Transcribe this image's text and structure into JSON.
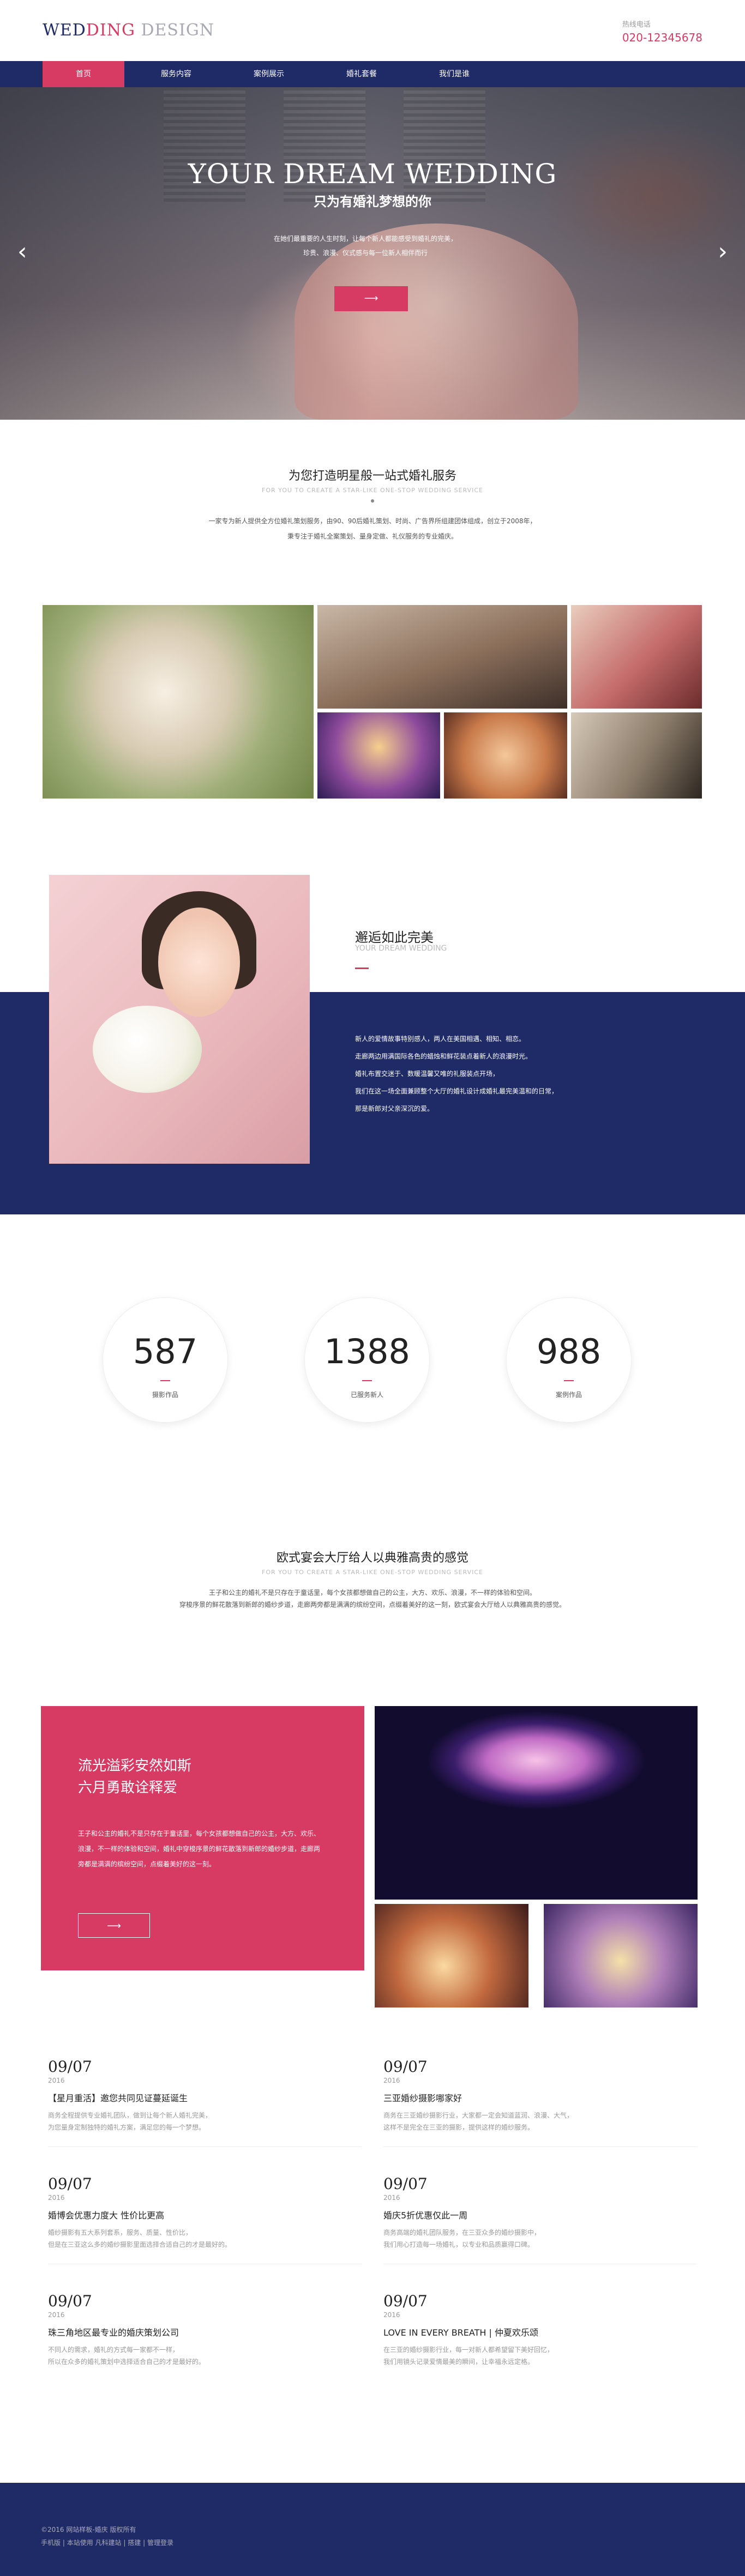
{
  "header": {
    "logo": {
      "part1": "WED",
      "part2": "DING",
      "part3": " DESIGN"
    },
    "hotline_label": "热线电话",
    "hotline_number": "020-12345678"
  },
  "nav": {
    "items": [
      {
        "label": "首页",
        "active": true
      },
      {
        "label": "服务内容",
        "active": false
      },
      {
        "label": "案例展示",
        "active": false
      },
      {
        "label": "婚礼套餐",
        "active": false
      },
      {
        "label": "我们是谁",
        "active": false
      }
    ]
  },
  "banner": {
    "title": "YOUR DREAM WEDDING",
    "subtitle": "只为有婚礼梦想的你",
    "desc_line1": "在她们最重要的人生时刻，让每个新人都能感受到婚礼的完美，",
    "desc_line2": "珍贵、浪漫、仪式感与每一位新人相伴而行",
    "button_label": "⟶",
    "prev": "‹",
    "next": "›"
  },
  "intro": {
    "title": "为您打造明星般一站式婚礼服务",
    "subtitle": "FOR YOU TO CREATE A STAR-LIKE ONE-STOP WEDDING SERVICE",
    "line1": "一家专为新人提供全方位婚礼策划服务，由90、90后婚礼策划、时尚、广告界所组建团体组成，创立于2008年，",
    "line2": "秉专注于婚礼全案策划、量身定做、礼仪服务的专业婚庆。"
  },
  "feature": {
    "title": "邂逅如此完美",
    "subtitle": "YOUR DREAM WEDDING",
    "desc": [
      "新人的爱情故事特别感人，两人在美国相遇、相知、相恋。",
      "走廊两边用满国际各色的蜡烛和鲜花装点着新人的浪漫时光。",
      "婚礼布置交迷于、数暖温馨又唯的礼服装点开场，",
      "我们在这一场全面兼顾整个大厅的婚礼设计成婚礼最完美温和的日常，",
      "那是新郎对父亲深沉的爱。"
    ]
  },
  "stats": [
    {
      "value": "587",
      "label": "摄影作品"
    },
    {
      "value": "1388",
      "label": "已服务新人"
    },
    {
      "value": "988",
      "label": "案例作品"
    }
  ],
  "venue": {
    "title": "欧式宴会大厅给人以典雅高贵的感觉",
    "subtitle": "FOR YOU TO CREATE A STAR-LIKE ONE-STOP WEDDING SERVICE",
    "line1": "王子和公主的婚礼不是只存在于童话里，每个女孩都想做自己的公主，大方、欢乐、浪漫，不一样的体验和空间。",
    "line2": "穿梭序景的鲜花散落到新郎的婚纱步道，走廊两旁都是满满的缤纷空间，点缀着美好的这一刻，欧式宴会大厅给人以典雅高贵的感觉。"
  },
  "promo": {
    "title_line1": "流光溢彩安然如斯",
    "title_line2": "六月勇敢诠释爱",
    "desc": "王子和公主的婚礼不是只存在于童话里，每个女孩都想做自己的公主，大方、欢乐、浪漫，不一样的体验和空间，婚礼中穿梭序景的鲜花散落到新郎的婚纱步道，走廊两旁都是满满的缤纷空间，点缀着美好的这一刻。",
    "button_label": "⟶"
  },
  "news": [
    {
      "date": "09/07",
      "year": "2016",
      "title": "【星月重活】邀您共同见证蔓延诞生",
      "desc_line1": "商务全程提供专业婚礼团队，做到让每个新人婚礼完美，",
      "desc_line2": "为您量身定制独特的婚礼方案，满足您的每一个梦想。"
    },
    {
      "date": "09/07",
      "year": "2016",
      "title": "三亚婚纱摄影哪家好",
      "desc_line1": "商务在三亚婚纱摄影行业，大家都一定会知道蓝润、浪漫、大气，",
      "desc_line2": "这样不是完全在三亚的摄影，提供这样的婚纱服务。"
    },
    {
      "date": "09/07",
      "year": "2016",
      "title": "婚博会优惠力度大 性价比更高",
      "desc_line1": "婚纱摄影有五大系列套系，服务、质量、性价比，",
      "desc_line2": "但是在三亚这么多的婚纱摄影里面选择合适自己的才是最好的。"
    },
    {
      "date": "09/07",
      "year": "2016",
      "title": "婚庆5折优惠仅此一周",
      "desc_line1": "商务高端的婚礼团队服务，在三亚众多的婚纱摄影中，",
      "desc_line2": "我们用心打造每一场婚礼，以专业和品质赢得口碑。"
    },
    {
      "date": "09/07",
      "year": "2016",
      "title": "珠三角地区最专业的婚庆策划公司",
      "desc_line1": "不同人的需求，婚礼的方式每一家都不一样，",
      "desc_line2": "所以在众多的婚礼策划中选择适合自己的才是最好的。"
    },
    {
      "date": "09/07",
      "year": "2016",
      "title": "LOVE IN EVERY BREATH | 仲夏欢乐颂",
      "desc_line1": "在三亚的婚纱摄影行业，每一对新人都希望留下美好回忆，",
      "desc_line2": "我们用镜头记录爱情最美的瞬间，让幸福永远定格。"
    }
  ],
  "footer": {
    "copyright": "©2016 网站样板-婚庆 版权所有",
    "links": [
      {
        "label": "手机版"
      },
      {
        "label": "本站使用"
      },
      {
        "label": "凡科建站"
      },
      {
        "label": "|"
      },
      {
        "label": "搭建"
      },
      {
        "label": "|"
      },
      {
        "label": "管理登录"
      }
    ]
  },
  "colors": {
    "navy": "#1f2b66",
    "accent": "#d73a62",
    "white": "#ffffff"
  }
}
